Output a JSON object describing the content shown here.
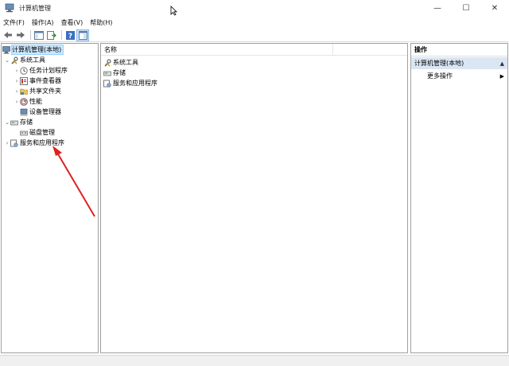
{
  "window": {
    "title": "计算机管理",
    "minimize": "—",
    "maximize": "☐",
    "close": "✕"
  },
  "menu": [
    "文件(F)",
    "操作(A)",
    "查看(V)",
    "帮助(H)"
  ],
  "toolbar": {
    "icons": [
      "back-arrow-icon",
      "forward-arrow-icon",
      "show-hide-tree-icon",
      "export-list-icon",
      "help-icon",
      "properties-icon"
    ]
  },
  "tree": {
    "root": "计算机管理(本地)",
    "items": [
      {
        "label": "系统工具",
        "icon": "tools-icon",
        "expanded": true
      },
      {
        "label": "任务计划程序",
        "icon": "clock-icon"
      },
      {
        "label": "事件查看器",
        "icon": "event-viewer-icon"
      },
      {
        "label": "共享文件夹",
        "icon": "shared-folder-icon"
      },
      {
        "label": "性能",
        "icon": "performance-icon"
      },
      {
        "label": "设备管理器",
        "icon": "device-manager-icon"
      },
      {
        "label": "存储",
        "icon": "storage-icon",
        "expanded": true
      },
      {
        "label": "磁盘管理",
        "icon": "disk-icon"
      },
      {
        "label": "服务和应用程序",
        "icon": "services-icon"
      }
    ]
  },
  "list": {
    "column": "名称",
    "items": [
      "系统工具",
      "存储",
      "服务和应用程序"
    ]
  },
  "actions": {
    "header": "操作",
    "section": "计算机管理(本地)",
    "item": "更多操作"
  },
  "colors": {
    "pane_border": "#a0a0a0",
    "selection": "#cce8ff",
    "action_section": "#dbe6f4",
    "annotation_arrow": "#e02020"
  }
}
